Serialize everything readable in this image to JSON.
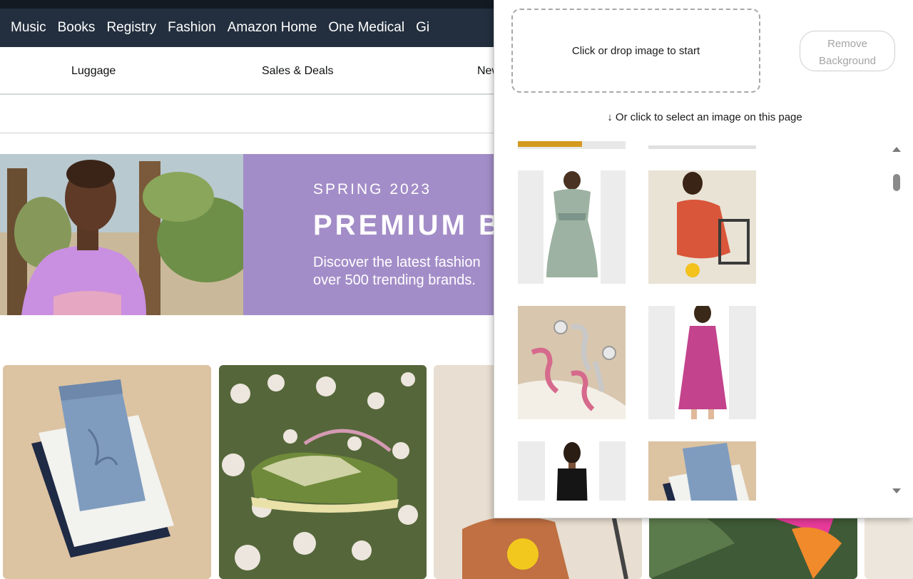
{
  "topnav": {
    "items": [
      "Music",
      "Books",
      "Registry",
      "Fashion",
      "Amazon Home",
      "One Medical",
      "Gi"
    ]
  },
  "subnav": {
    "items": [
      "Luggage",
      "Sales & Deals",
      "New"
    ]
  },
  "hero": {
    "eyebrow": "SPRING 2023",
    "title": "PREMIUM BR",
    "subtitle_line1": "Discover the latest fashion",
    "subtitle_line2": "over 500 trending brands."
  },
  "popup": {
    "dropzone_label": "Click or drop image to start",
    "remove_button_line1": "Remove",
    "remove_button_line2": "Background",
    "hint": "↓ Or click to select an image on this page"
  },
  "colors": {
    "nav_bg": "#232f3e",
    "hero_panel": "#a38dc8",
    "disabled_text": "#a4a4a4"
  }
}
